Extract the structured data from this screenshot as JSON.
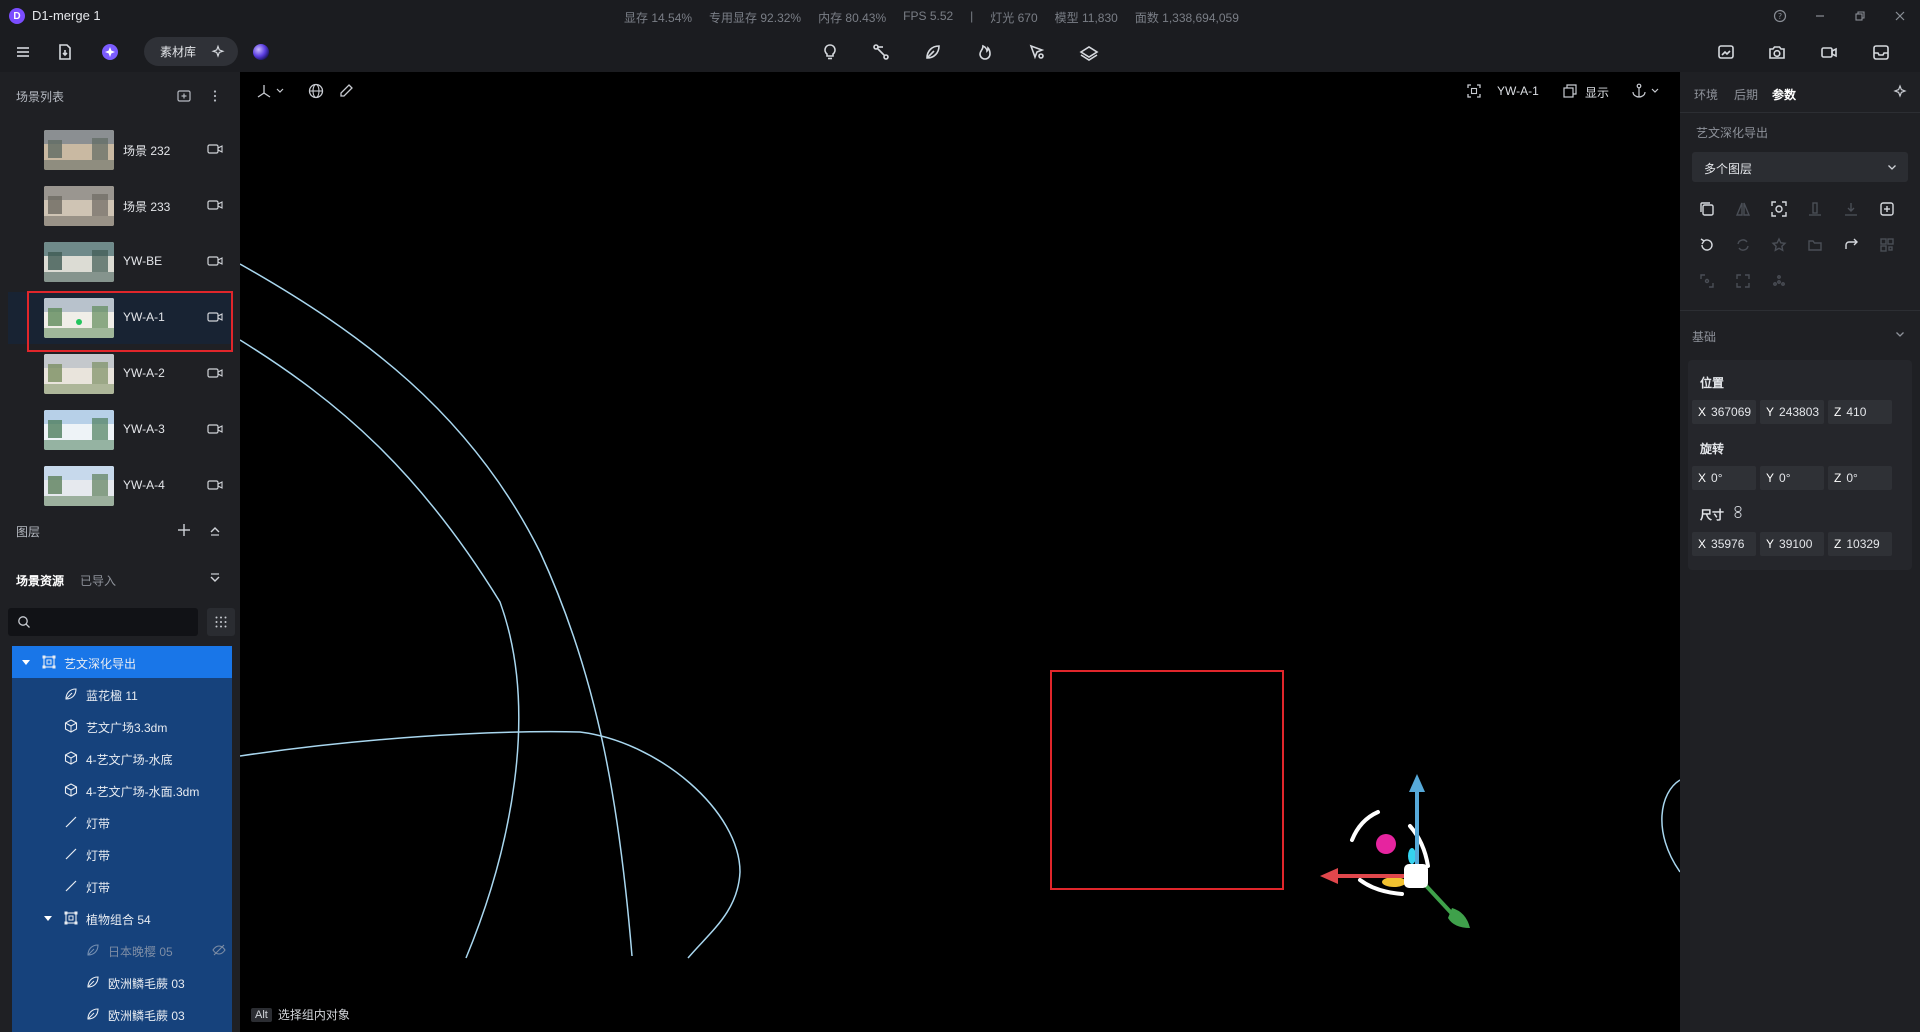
{
  "app": {
    "logo": "D",
    "title": "D1-merge 1"
  },
  "stats": [
    "显存 14.54%",
    "专用显存 92.32%",
    "内存 80.43%",
    "FPS 5.52",
    "|",
    "灯光 670",
    "模型 11,830",
    "面数 1,338,694,059"
  ],
  "toolbar": {
    "library_label": "素材库"
  },
  "left_panel": {
    "scene_list_title": "场景列表",
    "scenes": [
      {
        "label": "场景 232"
      },
      {
        "label": "场景 233"
      },
      {
        "label": "YW-BE"
      },
      {
        "label": "YW-A-1",
        "selected": true
      },
      {
        "label": "YW-A-2"
      },
      {
        "label": "YW-A-3"
      },
      {
        "label": "YW-A-4"
      }
    ],
    "layers_title": "图层",
    "resource_tab_active": "场景资源",
    "resource_tab_other": "已导入",
    "search_placeholder": "",
    "tree": [
      {
        "label": "艺文深化导出",
        "icon": "group-icon",
        "level": 0,
        "expanded": true,
        "root": true
      },
      {
        "label": "蓝花楹 11",
        "icon": "leaf-icon",
        "level": 1
      },
      {
        "label": "艺文广场3.3dm",
        "icon": "cube-icon",
        "level": 1
      },
      {
        "label": "4-艺文广场-水底",
        "icon": "cube-icon",
        "level": 1
      },
      {
        "label": "4-艺文广场-水面.3dm",
        "icon": "cube-icon",
        "level": 1
      },
      {
        "label": "灯带",
        "icon": "line-icon",
        "level": 1
      },
      {
        "label": "灯带",
        "icon": "line-icon",
        "level": 1
      },
      {
        "label": "灯带",
        "icon": "line-icon",
        "level": 1
      },
      {
        "label": "植物组合 54",
        "icon": "group-icon",
        "level": 1,
        "expanded": true
      },
      {
        "label": "日本晚樱 05",
        "icon": "leaf-icon",
        "level": 2,
        "hidden": true
      },
      {
        "label": "欧洲鳞毛蕨 03",
        "icon": "leaf-icon",
        "level": 2
      },
      {
        "label": "欧洲鳞毛蕨 03",
        "icon": "leaf-icon",
        "level": 2
      }
    ]
  },
  "viewport": {
    "camera_name": "YW-A-1",
    "display_label": "显示",
    "hint_key": "Alt",
    "hint_text": "选择组内对象"
  },
  "right_panel": {
    "tabs": [
      "环境",
      "后期",
      "参数"
    ],
    "active_tab": "参数",
    "object_name": "艺文深化导出",
    "layer_dropdown": "多个图层",
    "basic_title": "基础",
    "position_label": "位置",
    "rotation_label": "旋转",
    "size_label": "尺寸",
    "position": {
      "x": "367069",
      "y": "243803",
      "z": "410"
    },
    "rotation": {
      "x": "0°",
      "y": "0°",
      "z": "0°"
    },
    "size": {
      "x": "35976",
      "y": "39100",
      "z": "10329"
    }
  },
  "colors": {
    "accent": "#1976e8",
    "tree_bg": "#16427c",
    "highlight": "#e0262b",
    "curve": "#a9d7ef",
    "gizmo_x": "#e0474c",
    "gizmo_y": "#56a9d9",
    "gizmo_z": "#3fa14b",
    "gizmo_magenta": "#e6249f",
    "gizmo_yellow": "#f2c230",
    "gizmo_cyan": "#35d3f0"
  }
}
